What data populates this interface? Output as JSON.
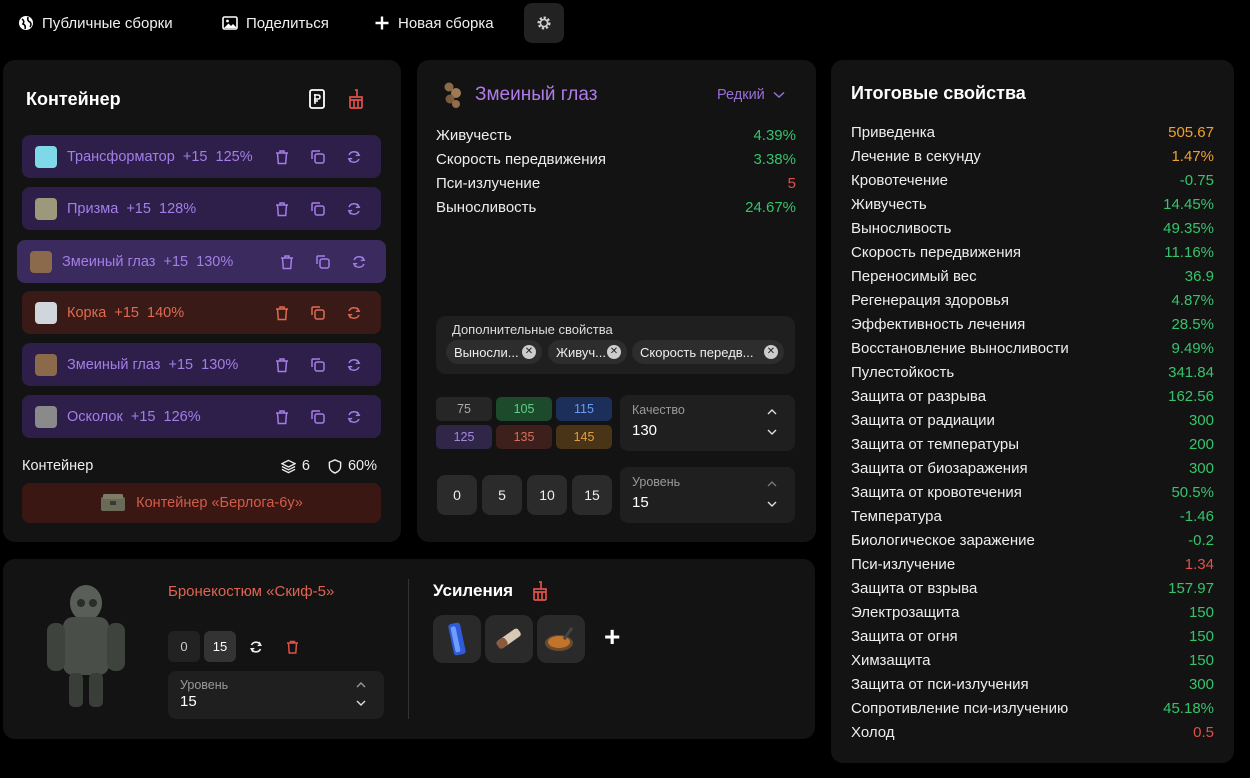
{
  "nav": {
    "public_label": "Публичные сборки",
    "share_label": "Поделиться",
    "new_label": "Новая сборка"
  },
  "container": {
    "title": "Контейнер",
    "items": [
      {
        "name": "Трансформатор",
        "level": "+15",
        "quality": "125%",
        "tone": "purple"
      },
      {
        "name": "Призма",
        "level": "+15",
        "quality": "128%",
        "tone": "purple"
      },
      {
        "name": "Змеиный глаз",
        "level": "+15",
        "quality": "130%",
        "tone": "purple"
      },
      {
        "name": "Корка",
        "level": "+15",
        "quality": "140%",
        "tone": "red"
      },
      {
        "name": "Змеиный глаз",
        "level": "+15",
        "quality": "130%",
        "tone": "purple"
      },
      {
        "name": "Осколок",
        "level": "+15",
        "quality": "126%",
        "tone": "purple"
      }
    ],
    "footer_label": "Контейнер",
    "slots": "6",
    "protection": "60%",
    "container_name": "Контейнер «Берлога-6у»"
  },
  "artifact": {
    "name": "Змеиный глаз",
    "rarity": "Редкий",
    "props": [
      {
        "name": "Живучесть",
        "value": "4.39%",
        "tone": "green"
      },
      {
        "name": "Скорость передвижения",
        "value": "3.38%",
        "tone": "green"
      },
      {
        "name": "Пси-излучение",
        "value": "5",
        "tone": "red"
      },
      {
        "name": "Выносливость",
        "value": "24.67%",
        "tone": "green"
      }
    ],
    "extras_label": "Дополнительные свойства",
    "extras": [
      "Выносли...",
      "Живуч...",
      "Скорость передв..."
    ],
    "quality_presets": [
      "75",
      "105",
      "115",
      "125",
      "135",
      "145"
    ],
    "quality_label": "Качество",
    "quality_value": "130",
    "level_presets": [
      "0",
      "5",
      "10",
      "15"
    ],
    "level_label": "Уровень",
    "level_value": "15"
  },
  "totals": {
    "title": "Итоговые свойства",
    "rows": [
      {
        "name": "Приведенка",
        "value": "505.67",
        "tone": "orange"
      },
      {
        "name": "Лечение в секунду",
        "value": "1.47%",
        "tone": "orange"
      },
      {
        "name": "Кровотечение",
        "value": "-0.75",
        "tone": "green"
      },
      {
        "name": "Живучесть",
        "value": "14.45%",
        "tone": "green"
      },
      {
        "name": "Выносливость",
        "value": "49.35%",
        "tone": "green"
      },
      {
        "name": "Скорость передвижения",
        "value": "11.16%",
        "tone": "green"
      },
      {
        "name": "Переносимый вес",
        "value": "36.9",
        "tone": "green"
      },
      {
        "name": "Регенерация здоровья",
        "value": "4.87%",
        "tone": "green"
      },
      {
        "name": "Эффективность лечения",
        "value": "28.5%",
        "tone": "green"
      },
      {
        "name": "Восстановление выносливости",
        "value": "9.49%",
        "tone": "green"
      },
      {
        "name": "Пулестойкость",
        "value": "341.84",
        "tone": "green"
      },
      {
        "name": "Защита от разрыва",
        "value": "162.56",
        "tone": "green"
      },
      {
        "name": "Защита от радиации",
        "value": "300",
        "tone": "green"
      },
      {
        "name": "Защита от температуры",
        "value": "200",
        "tone": "green"
      },
      {
        "name": "Защита от биозаражения",
        "value": "300",
        "tone": "green"
      },
      {
        "name": "Защита от кровотечения",
        "value": "50.5%",
        "tone": "green"
      },
      {
        "name": "Температура",
        "value": "-1.46",
        "tone": "green"
      },
      {
        "name": "Биологическое заражение",
        "value": "-0.2",
        "tone": "green"
      },
      {
        "name": "Пси-излучение",
        "value": "1.34",
        "tone": "red"
      },
      {
        "name": "Защита от взрыва",
        "value": "157.97",
        "tone": "green"
      },
      {
        "name": "Электрозащита",
        "value": "150",
        "tone": "green"
      },
      {
        "name": "Защита от огня",
        "value": "150",
        "tone": "green"
      },
      {
        "name": "Химзащита",
        "value": "150",
        "tone": "green"
      },
      {
        "name": "Защита от пси-излучения",
        "value": "300",
        "tone": "green"
      },
      {
        "name": "Сопротивление пси-излучению",
        "value": "45.18%",
        "tone": "green"
      },
      {
        "name": "Холод",
        "value": "0.5",
        "tone": "red"
      }
    ]
  },
  "armor": {
    "name": "Бронекостюм «Скиф-5»",
    "level_min": "0",
    "level_max": "15",
    "level_label": "Уровень",
    "level_value": "15",
    "boosts_title": "Усиления",
    "add_label": "+"
  }
}
